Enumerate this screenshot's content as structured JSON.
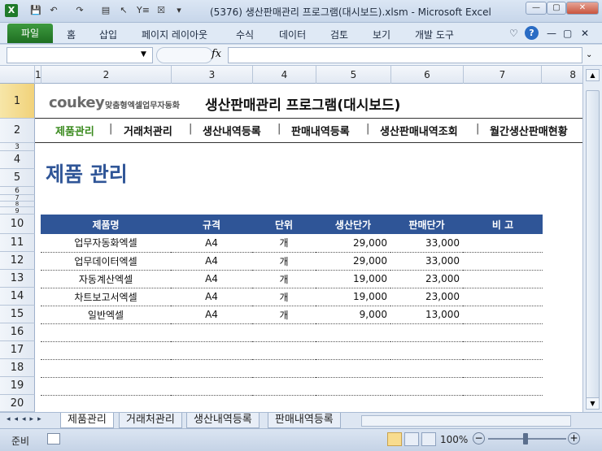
{
  "window": {
    "title": "(5376) 생산판매관리 프로그램(대시보드).xlsm  -  Microsoft Excel",
    "controls": [
      "—",
      "▢",
      "✕"
    ],
    "quick_access": [
      "X",
      "💾",
      "↶",
      "↷",
      "▤",
      "↖",
      "Y≡",
      "☒",
      "▾"
    ]
  },
  "ribbon": {
    "file_label": "파일",
    "tabs": [
      "홈",
      "삽입",
      "페이지 레이아웃",
      "수식",
      "데이터",
      "검토",
      "보기",
      "개발 도구"
    ],
    "right_icons": [
      "♡",
      "?",
      "—",
      "▢",
      "✕"
    ]
  },
  "formula_bar": {
    "name_value": "",
    "fx_label": "fx",
    "formula_value": ""
  },
  "columns": [
    "1",
    "2",
    "3",
    "4",
    "5",
    "6",
    "7",
    "8"
  ],
  "rows": [
    "1",
    "2",
    "3",
    "4",
    "5",
    "6",
    "7",
    "8",
    "9",
    "10",
    "11",
    "12",
    "13",
    "14",
    "15",
    "16",
    "17",
    "18",
    "19",
    "20"
  ],
  "header": {
    "logo_main": "coukey",
    "logo_sub": "맞춤형엑셀업무자동화",
    "program_title": "생산판매관리 프로그램(대시보드)"
  },
  "nav": {
    "items": [
      "제품관리",
      "거래처관리",
      "생산내역등록",
      "판매내역등록",
      "생산판매내역조회",
      "월간생산판매현황"
    ],
    "separator": "|",
    "active_color": "#3a8a1e"
  },
  "section_title": "제품 관리",
  "table": {
    "headers": [
      "제품명",
      "규격",
      "단위",
      "생산단가",
      "판매단가",
      "비 고"
    ],
    "rows": [
      [
        "업무자동화엑셀",
        "A4",
        "개",
        "29,000",
        "33,000",
        ""
      ],
      [
        "업무데이터엑셀",
        "A4",
        "개",
        "29,000",
        "33,000",
        ""
      ],
      [
        "자동계산엑셀",
        "A4",
        "개",
        "19,000",
        "23,000",
        ""
      ],
      [
        "차트보고서엑셀",
        "A4",
        "개",
        "19,000",
        "23,000",
        ""
      ],
      [
        "일반엑셀",
        "A4",
        "개",
        "9,000",
        "13,000",
        ""
      ],
      [
        "",
        "",
        "",
        "",
        "",
        ""
      ],
      [
        "",
        "",
        "",
        "",
        "",
        ""
      ],
      [
        "",
        "",
        "",
        "",
        "",
        ""
      ],
      [
        "",
        "",
        "",
        "",
        "",
        ""
      ],
      [
        "",
        "",
        "",
        "",
        "",
        ""
      ]
    ],
    "header_color": "#2f5597"
  },
  "sheet_tabs": [
    "제품관리",
    "거래처관리",
    "생산내역등록",
    "판매내역등록"
  ],
  "status": {
    "ready": "준비",
    "zoom": "100%"
  }
}
